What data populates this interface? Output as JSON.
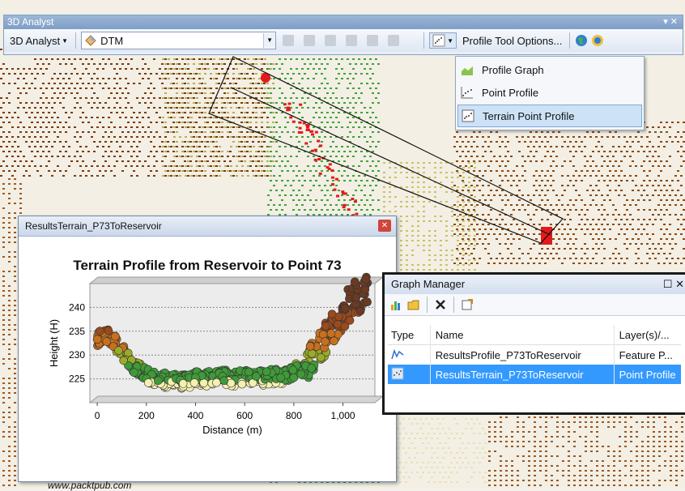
{
  "toolbar": {
    "title": "3D Analyst",
    "close_glyph": "▾ ✕",
    "menu_label": "3D Analyst",
    "layer": "DTM",
    "profile_options_label": "Profile Tool Options..."
  },
  "profile_menu": {
    "items": [
      {
        "label": "Profile Graph",
        "icon": "profile-graph-icon"
      },
      {
        "label": "Point Profile",
        "icon": "point-profile-icon"
      },
      {
        "label": "Terrain Point Profile",
        "icon": "terrain-point-profile-icon"
      }
    ],
    "selected_index": 2
  },
  "results_window": {
    "title": "ResultsTerrain_P73ToReservoir",
    "close_glyph": "✕",
    "watermark": "www.packtpub.com"
  },
  "chart_data": {
    "type": "scatter",
    "title": "Terrain Profile from Reservoir to Point 73",
    "xlabel": "Distance (m)",
    "ylabel": "Height (H)",
    "xlim": [
      -30,
      1130
    ],
    "ylim": [
      220,
      245
    ],
    "xticks": [
      0,
      200,
      400,
      600,
      800,
      1000
    ],
    "xtick_labels": [
      "0",
      "200",
      "400",
      "600",
      "800",
      "1,000"
    ],
    "yticks": [
      225,
      230,
      235,
      240
    ],
    "profile": {
      "x": [
        0,
        30,
        60,
        90,
        120,
        150,
        180,
        210,
        250,
        300,
        350,
        400,
        450,
        500,
        550,
        600,
        650,
        700,
        750,
        800,
        850,
        900,
        950,
        1000,
        1050,
        1100
      ],
      "y": [
        233,
        234,
        233,
        231,
        229,
        227,
        226,
        225,
        224.5,
        224,
        224,
        224.5,
        224.5,
        225,
        224.5,
        225,
        224.5,
        225,
        225,
        226,
        227,
        230,
        234,
        238,
        241,
        242
      ]
    }
  },
  "graph_manager": {
    "title": "Graph Manager",
    "controls": "☐ ✕",
    "columns": [
      "Type",
      "Name",
      "Layer(s)/..."
    ],
    "rows": [
      {
        "name": "ResultsProfile_P73ToReservoir",
        "layer": "Feature P...",
        "icon": "line-graph-icon"
      },
      {
        "name": "ResultsTerrain_P73ToReservoir",
        "layer": "Point Profile",
        "icon": "point-graph-icon"
      }
    ]
  },
  "colors": {
    "selection": "#3399ff",
    "marker": "#e31a1c"
  }
}
